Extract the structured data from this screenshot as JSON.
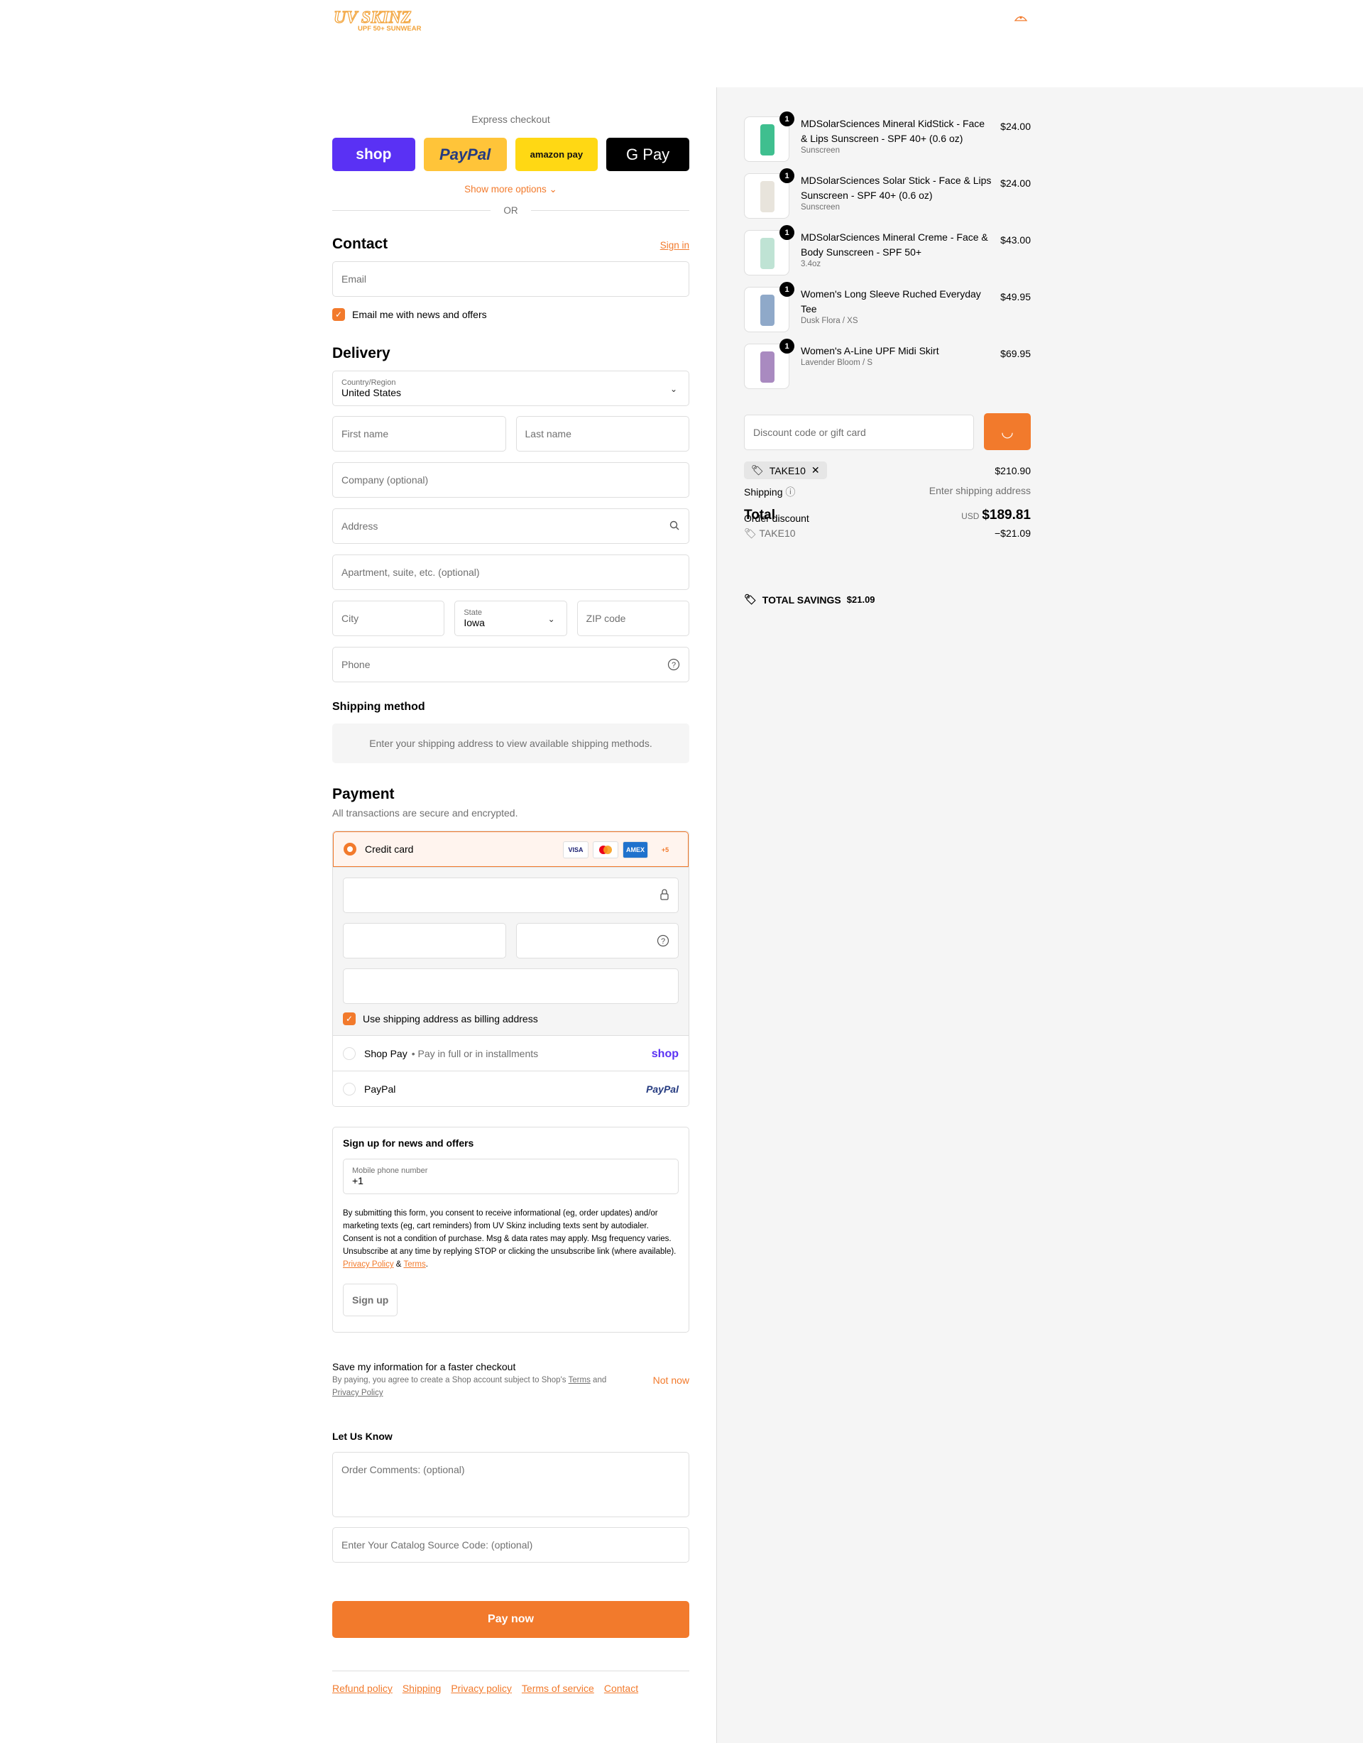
{
  "store": {
    "logo_text": "UV Skinz",
    "logo_tagline": "UPF 50+ SUNWEAR"
  },
  "express": {
    "title": "Express checkout",
    "buttons": [
      "shop",
      "PayPal",
      "amazon pay",
      "G Pay"
    ],
    "more_options": "Show more options",
    "or": "OR"
  },
  "contact": {
    "heading": "Contact",
    "sign_in": "Sign in",
    "email_placeholder": "Email",
    "newsletter_label": "Email me with news and offers"
  },
  "delivery": {
    "heading": "Delivery",
    "country_label": "Country/Region",
    "country_value": "United States",
    "first_name": "First name",
    "last_name": "Last name",
    "company": "Company (optional)",
    "address": "Address",
    "apartment": "Apartment, suite, etc. (optional)",
    "city": "City",
    "state_label": "State",
    "state_value": "Iowa",
    "zip": "ZIP code",
    "phone": "Phone"
  },
  "shipping_method": {
    "heading": "Shipping method",
    "message": "Enter your shipping address to view available shipping methods."
  },
  "payment": {
    "heading": "Payment",
    "subtitle": "All transactions are secure and encrypted.",
    "credit_card_label": "Credit card",
    "card_brands": [
      "VISA",
      "MC",
      "AMEX",
      "+5"
    ],
    "billing_same_label": "Use shipping address as billing address",
    "shop_pay_label": "Shop Pay",
    "shop_pay_sub": "Pay in full or in installments",
    "shop_pay_brand": "shop",
    "paypal_label": "PayPal",
    "paypal_brand": "PayPal"
  },
  "sms_signup": {
    "heading": "Sign up for news and offers",
    "phone_label": "Mobile phone number",
    "phone_value": "+1",
    "fine_print": "By submitting this form, you consent to receive informational (eg, order updates) and/or marketing texts (eg, cart reminders) from UV Skinz including texts sent by autodialer. Consent is not a condition of purchase. Msg & data rates may apply. Msg frequency varies. Unsubscribe at any time by replying STOP or clicking the unsubscribe link (where available).",
    "privacy_link": "Privacy Policy",
    "amp": "&",
    "terms_link": "Terms",
    "period": ".",
    "button": "Sign up"
  },
  "save_info": {
    "title": "Save my information for a faster checkout",
    "sub_prefix": "By paying, you agree to create a Shop account subject to Shop's",
    "terms": "Terms",
    "and": "and",
    "privacy": "Privacy Policy",
    "not_now": "Not now"
  },
  "let_us_know": {
    "heading": "Let Us Know",
    "comments_placeholder": "Order Comments: (optional)",
    "catalog_placeholder": "Enter Your Catalog Source Code: (optional)"
  },
  "pay_now": "Pay now",
  "footer_links": [
    "Refund policy",
    "Shipping",
    "Privacy policy",
    "Terms of service",
    "Contact"
  ],
  "cart": {
    "items": [
      {
        "qty": "1",
        "name": "MDSolarSciences Mineral KidStick - Face & Lips Sunscreen - SPF 40+ (0.6 oz)",
        "variant": "Sunscreen",
        "price": "$24.00",
        "thumb_color": "#3fbf8f"
      },
      {
        "qty": "1",
        "name": "MDSolarSciences Solar Stick - Face & Lips Sunscreen - SPF 40+ (0.6 oz)",
        "variant": "Sunscreen",
        "price": "$24.00",
        "thumb_color": "#e8e4dc"
      },
      {
        "qty": "1",
        "name": "MDSolarSciences Mineral Creme - Face & Body Sunscreen - SPF 50+",
        "variant": "3.4oz",
        "price": "$43.00",
        "thumb_color": "#bfe3d4"
      },
      {
        "qty": "1",
        "name": "Women's Long Sleeve Ruched Everyday Tee",
        "variant": "Dusk Flora / XS",
        "price": "$49.95",
        "thumb_color": "#8fa9c9"
      },
      {
        "qty": "1",
        "name": "Women's A-Line UPF Midi Skirt",
        "variant": "Lavender Bloom / S",
        "price": "$69.95",
        "thumb_color": "#a98ac0"
      }
    ],
    "discount_placeholder": "Discount code or gift card",
    "applied_code": "TAKE10",
    "subtotal_value": "$210.90",
    "shipping_label": "Shipping",
    "shipping_value": "Enter shipping address",
    "order_discount_label": "Order discount",
    "discount_code": "TAKE10",
    "discount_value": "−$21.09",
    "total_label": "Total",
    "currency": "USD",
    "total_value": "$189.81",
    "savings_label": "TOTAL SAVINGS",
    "savings_value": "$21.09"
  },
  "colors": {
    "accent": "#f27a2c",
    "shop_purple": "#5a31f4",
    "paypal_yellow": "#ffc439"
  }
}
